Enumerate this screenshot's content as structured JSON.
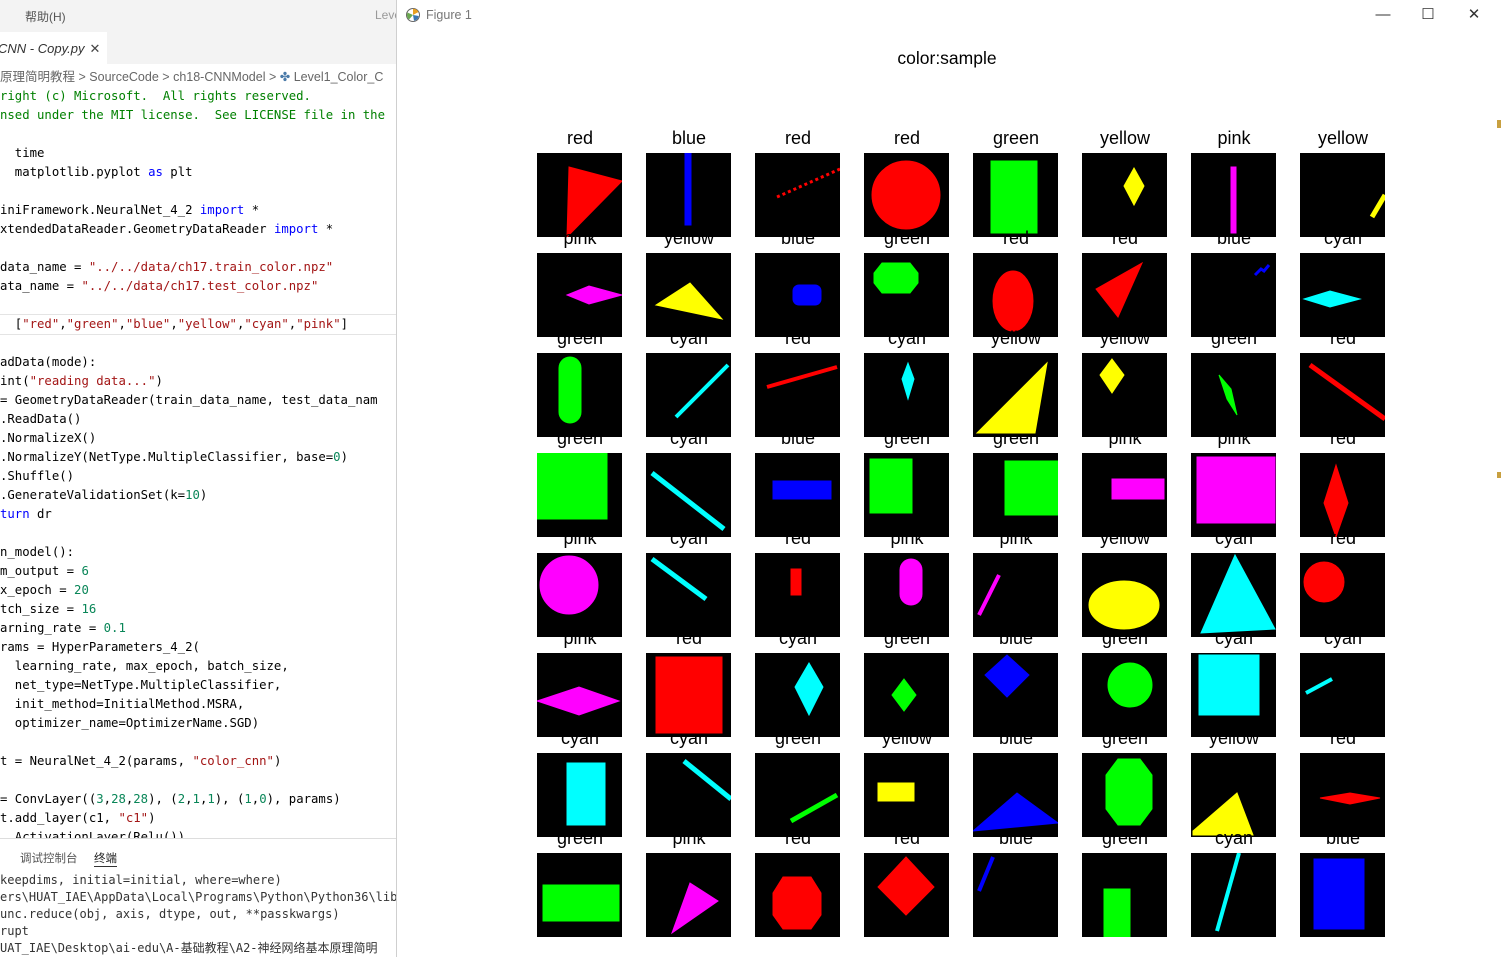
{
  "editor": {
    "menu": {
      "item1": "帮助(H)",
      "item2": "Leve"
    },
    "tab": {
      "title": "CNN - Copy.py",
      "close": "✕"
    },
    "breadcrumb": {
      "p1": "原理简明教程",
      "sep": ">",
      "p2": "SourceCode",
      "p3": "ch18-CNNModel",
      "p4": "Level1_Color_C"
    },
    "code": [
      [
        [
          "cm",
          "right (c) Microsoft.  All rights reserved."
        ]
      ],
      [
        [
          "cm",
          "nsed under the MIT license.  See LICENSE file in the"
        ]
      ],
      [],
      [
        [
          "",
          "  time"
        ]
      ],
      [
        [
          "",
          "  matplotlib.pyplot "
        ],
        [
          "kw",
          "as"
        ],
        [
          "",
          " plt"
        ]
      ],
      [],
      [
        [
          "",
          "iniFramework.NeuralNet_4_2 "
        ],
        [
          "kw",
          "import"
        ],
        [
          "",
          " *"
        ]
      ],
      [
        [
          "",
          "xtendedDataReader.GeometryDataReader "
        ],
        [
          "kw",
          "import"
        ],
        [
          "",
          " *"
        ]
      ],
      [],
      [
        [
          "",
          "data_name = "
        ],
        [
          "st",
          "\"../../data/ch17.train_color.npz\""
        ]
      ],
      [
        [
          "",
          "ata_name = "
        ],
        [
          "st",
          "\"../../data/ch17.test_color.npz\""
        ]
      ],
      [],
      [
        [
          "",
          "  ["
        ],
        [
          "st",
          "\"red\""
        ],
        [
          "",
          ","
        ],
        [
          "st",
          "\"green\""
        ],
        [
          "",
          ","
        ],
        [
          "st",
          "\"blue\""
        ],
        [
          "",
          ","
        ],
        [
          "st",
          "\"yellow\""
        ],
        [
          "",
          ","
        ],
        [
          "st",
          "\"cyan\""
        ],
        [
          "",
          ","
        ],
        [
          "st",
          "\"pink\""
        ],
        [
          "",
          "]"
        ]
      ],
      [],
      [
        [
          "",
          "adData(mode):"
        ]
      ],
      [
        [
          "",
          "int("
        ],
        [
          "st",
          "\"reading data...\""
        ],
        [
          "",
          ")"
        ]
      ],
      [
        [
          "",
          "= GeometryDataReader(train_data_name, test_data_nam"
        ]
      ],
      [
        [
          "",
          ".ReadData()"
        ]
      ],
      [
        [
          "",
          ".NormalizeX()"
        ]
      ],
      [
        [
          "",
          ".NormalizeY(NetType.MultipleClassifier, base="
        ],
        [
          "nm",
          "0"
        ],
        [
          "",
          ")"
        ]
      ],
      [
        [
          "",
          ".Shuffle()"
        ]
      ],
      [
        [
          "",
          ".GenerateValidationSet(k="
        ],
        [
          "nm",
          "10"
        ],
        [
          "",
          ")"
        ]
      ],
      [
        [
          "kw",
          "turn"
        ],
        [
          "",
          " dr"
        ]
      ],
      [],
      [
        [
          "",
          "n_model():"
        ]
      ],
      [
        [
          "",
          "m_output = "
        ],
        [
          "nm",
          "6"
        ]
      ],
      [
        [
          "",
          "x_epoch = "
        ],
        [
          "nm",
          "20"
        ]
      ],
      [
        [
          "",
          "tch_size = "
        ],
        [
          "nm",
          "16"
        ]
      ],
      [
        [
          "",
          "arning_rate = "
        ],
        [
          "nm",
          "0.1"
        ]
      ],
      [
        [
          "",
          "rams = HyperParameters_4_2("
        ]
      ],
      [
        [
          "",
          "  learning_rate, max_epoch, batch_size,"
        ]
      ],
      [
        [
          "",
          "  net_type=NetType.MultipleClassifier,"
        ]
      ],
      [
        [
          "",
          "  init_method=InitialMethod.MSRA,"
        ]
      ],
      [
        [
          "",
          "  optimizer_name=OptimizerName.SGD)"
        ]
      ],
      [],
      [
        [
          "",
          "t = NeuralNet_4_2(params, "
        ],
        [
          "st",
          "\"color_cnn\""
        ],
        [
          "",
          ")"
        ]
      ],
      [],
      [
        [
          "",
          "= ConvLayer(("
        ],
        [
          "nm",
          "3"
        ],
        [
          "",
          ","
        ],
        [
          "nm",
          "28"
        ],
        [
          "",
          ","
        ],
        [
          "nm",
          "28"
        ],
        [
          "",
          "), ("
        ],
        [
          "nm",
          "2"
        ],
        [
          "",
          ","
        ],
        [
          "nm",
          "1"
        ],
        [
          "",
          ","
        ],
        [
          "nm",
          "1"
        ],
        [
          "",
          "), ("
        ],
        [
          "nm",
          "1"
        ],
        [
          "",
          ","
        ],
        [
          "nm",
          "0"
        ],
        [
          "",
          "), params)"
        ]
      ],
      [
        [
          "",
          "t.add_layer(c1, "
        ],
        [
          "st",
          "\"c1\""
        ],
        [
          "",
          ")"
        ]
      ],
      [
        [
          "",
          "  ActivationLayer(Relu())"
        ]
      ]
    ],
    "panel": {
      "tab1": "调试控制台",
      "tab2": "终端"
    },
    "terminal": [
      "keepdims, initial=initial, where=where)",
      "ers\\HUAT_IAE\\AppData\\Local\\Programs\\Python\\Python36\\lib\\s",
      "unc.reduce(obj, axis, dtype, out, **passkwargs)",
      "rupt",
      "UAT_IAE\\Desktop\\ai-edu\\A-基础教程\\A2-神经网络基本原理简明"
    ]
  },
  "figure": {
    "window_title": "Figure 1",
    "buttons": {
      "minimize": "—",
      "maximize": "☐",
      "close": "✕"
    },
    "suptitle": "color:sample",
    "colors": {
      "red": "#ff0000",
      "blue": "#0000ff",
      "green": "#00ff00",
      "yellow": "#ffff00",
      "pink": "#ff00ff",
      "cyan": "#00ffff",
      "bg": "#000000"
    },
    "samples": [
      [
        {
          "label": "red",
          "color": "red",
          "shape": "triangle-right"
        },
        {
          "label": "blue",
          "color": "blue",
          "shape": "vline-thin"
        },
        {
          "label": "red",
          "color": "red",
          "shape": "dotted-line"
        },
        {
          "label": "red",
          "color": "red",
          "shape": "circle-big"
        },
        {
          "label": "green",
          "color": "green",
          "shape": "rect-tall"
        },
        {
          "label": "yellow",
          "color": "yellow",
          "shape": "diamond"
        },
        {
          "label": "pink",
          "color": "pink",
          "shape": "vline"
        },
        {
          "label": "yellow",
          "color": "yellow",
          "shape": "short-diag-corner"
        }
      ],
      [
        {
          "label": "pink",
          "color": "pink",
          "shape": "spindle-h-small"
        },
        {
          "label": "yellow",
          "color": "yellow",
          "shape": "triangle-flat"
        },
        {
          "label": "blue",
          "color": "blue",
          "shape": "small-rounded-rect"
        },
        {
          "label": "green",
          "color": "green",
          "shape": "octagon-h"
        },
        {
          "label": "red",
          "color": "red",
          "shape": "ellipse-v"
        },
        {
          "label": "red",
          "color": "red",
          "shape": "triangle-point"
        },
        {
          "label": "blue",
          "color": "blue",
          "shape": "tiny-squiggle"
        },
        {
          "label": "cyan",
          "color": "cyan",
          "shape": "spindle-h"
        }
      ],
      [
        {
          "label": "green",
          "color": "green",
          "shape": "capsule-v"
        },
        {
          "label": "cyan",
          "color": "cyan",
          "shape": "diag-line"
        },
        {
          "label": "red",
          "color": "red",
          "shape": "line-slight"
        },
        {
          "label": "cyan",
          "color": "cyan",
          "shape": "small-spindle-v"
        },
        {
          "label": "yellow",
          "color": "yellow",
          "shape": "triangle-big"
        },
        {
          "label": "yellow",
          "color": "yellow",
          "shape": "diamond-left"
        },
        {
          "label": "green",
          "color": "green",
          "shape": "leaf"
        },
        {
          "label": "red",
          "color": "red",
          "shape": "diag-down"
        }
      ],
      [
        {
          "label": "green",
          "color": "green",
          "shape": "square-corner"
        },
        {
          "label": "cyan",
          "color": "cyan",
          "shape": "diag-down-long"
        },
        {
          "label": "blue",
          "color": "blue",
          "shape": "rect-wide"
        },
        {
          "label": "green",
          "color": "green",
          "shape": "rect-med"
        },
        {
          "label": "green",
          "color": "green",
          "shape": "square-right"
        },
        {
          "label": "pink",
          "color": "pink",
          "shape": "rect-wide-right"
        },
        {
          "label": "pink",
          "color": "pink",
          "shape": "rect-big"
        },
        {
          "label": "red",
          "color": "red",
          "shape": "spindle-v"
        }
      ],
      [
        {
          "label": "pink",
          "color": "pink",
          "shape": "circle-left"
        },
        {
          "label": "cyan",
          "color": "cyan",
          "shape": "diag-short"
        },
        {
          "label": "red",
          "color": "red",
          "shape": "small-rect"
        },
        {
          "label": "pink",
          "color": "pink",
          "shape": "capsule-small"
        },
        {
          "label": "pink",
          "color": "pink",
          "shape": "line-up-short"
        },
        {
          "label": "yellow",
          "color": "yellow",
          "shape": "ellipse-h"
        },
        {
          "label": "cyan",
          "color": "cyan",
          "shape": "triangle-tall"
        },
        {
          "label": "red",
          "color": "red",
          "shape": "circle-med"
        }
      ],
      [
        {
          "label": "pink",
          "color": "pink",
          "shape": "spindle-h-wide"
        },
        {
          "label": "red",
          "color": "red",
          "shape": "rect-square-big"
        },
        {
          "label": "cyan",
          "color": "cyan",
          "shape": "diamond-tall"
        },
        {
          "label": "green",
          "color": "green",
          "shape": "diamond-small"
        },
        {
          "label": "blue",
          "color": "blue",
          "shape": "diamond-rot"
        },
        {
          "label": "green",
          "color": "green",
          "shape": "circle-green"
        },
        {
          "label": "cyan",
          "color": "cyan",
          "shape": "square-cyan"
        },
        {
          "label": "cyan",
          "color": "cyan",
          "shape": "line-short-up"
        }
      ],
      [
        {
          "label": "cyan",
          "color": "cyan",
          "shape": "rect-v"
        },
        {
          "label": "cyan",
          "color": "cyan",
          "shape": "diag-down-right"
        },
        {
          "label": "green",
          "color": "green",
          "shape": "line-up-right"
        },
        {
          "label": "yellow",
          "color": "yellow",
          "shape": "rect-tiny"
        },
        {
          "label": "blue",
          "color": "blue",
          "shape": "triangle-bottom"
        },
        {
          "label": "green",
          "color": "green",
          "shape": "octagon-v"
        },
        {
          "label": "yellow",
          "color": "yellow",
          "shape": "triangle-bottom-small"
        },
        {
          "label": "red",
          "color": "red",
          "shape": "spindle-h-red"
        }
      ],
      [
        {
          "label": "green",
          "color": "green",
          "shape": "rect-wide-green"
        },
        {
          "label": "pink",
          "color": "pink",
          "shape": "triangle-pink"
        },
        {
          "label": "red",
          "color": "red",
          "shape": "octagon-red"
        },
        {
          "label": "red",
          "color": "red",
          "shape": "diamond-red"
        },
        {
          "label": "blue",
          "color": "blue",
          "shape": "line-top-left"
        },
        {
          "label": "green",
          "color": "green",
          "shape": "rect-bottom"
        },
        {
          "label": "cyan",
          "color": "cyan",
          "shape": "line-long-up"
        },
        {
          "label": "blue",
          "color": "blue",
          "shape": "rect-blue-tall"
        }
      ]
    ]
  }
}
